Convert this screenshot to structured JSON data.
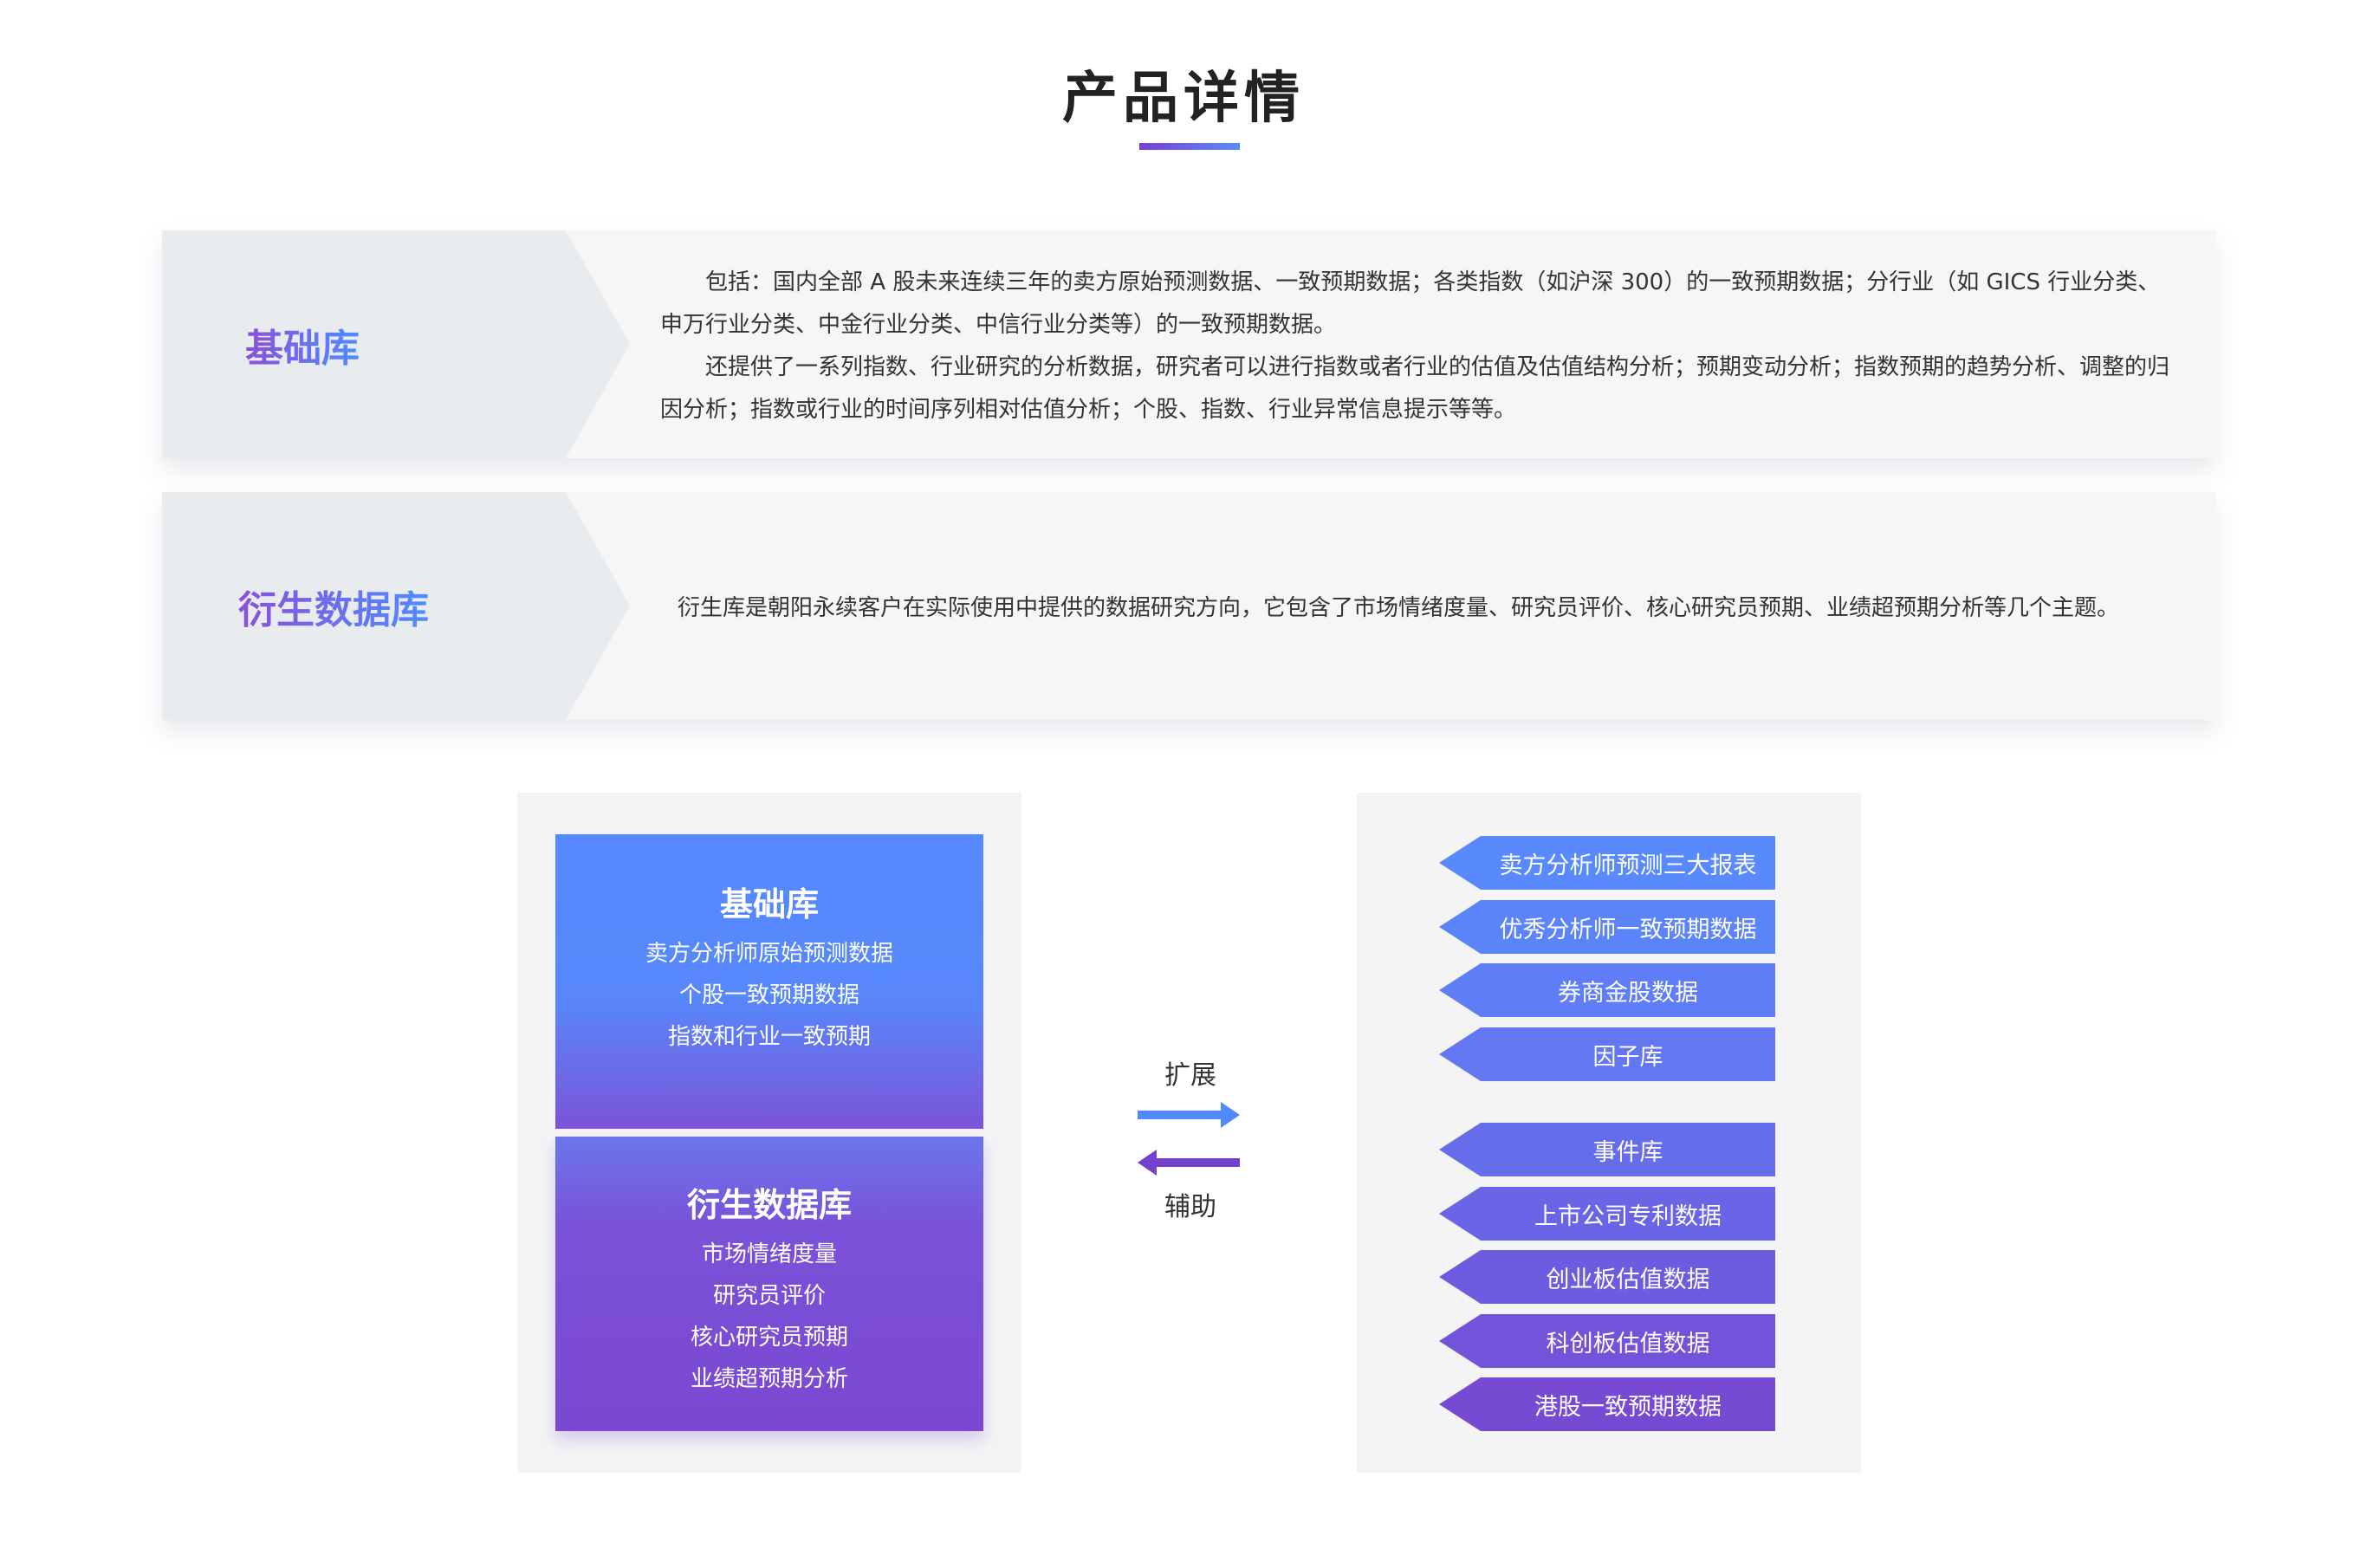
{
  "header": {
    "title": "产品详情"
  },
  "intro": {
    "basic": {
      "label": "基础库",
      "paragraphs": [
        "包括：国内全部 A 股未来连续三年的卖方原始预测数据、一致预期数据；各类指数（如沪深 300）的一致预期数据；分行业（如 GICS 行业分类、申万行业分类、中金行业分类、中信行业分类等）的一致预期数据。",
        "还提供了一系列指数、行业研究的分析数据，研究者可以进行指数或者行业的估值及估值结构分析；预期变动分析；指数预期的趋势分析、调整的归因分析；指数或行业的时间序列相对估值分析；个股、指数、行业异常信息提示等等。"
      ]
    },
    "derived": {
      "label": "衍生数据库",
      "text": "衍生库是朝阳永续客户在实际使用中提供的数据研究方向，它包含了市场情绪度量、研究员评价、核心研究员预期、业绩超预期分析等几个主题。"
    }
  },
  "diagram": {
    "basic_box": {
      "title": "基础库",
      "items": [
        "卖方分析师原始预测数据",
        "个股一致预期数据",
        "指数和行业一致预期"
      ]
    },
    "derived_box": {
      "title": "衍生数据库",
      "items": [
        "市场情绪度量",
        "研究员评价",
        "核心研究员预期",
        "业绩超预期分析"
      ]
    },
    "expand_label": "扩展",
    "assist_label": "辅助",
    "tags": [
      {
        "label": "卖方分析师预测三大报表",
        "color": "#5889fd"
      },
      {
        "label": "优秀分析师一致预期数据",
        "color": "#5b83fa"
      },
      {
        "label": "券商金股数据",
        "color": "#5f7df6"
      },
      {
        "label": "因子库",
        "color": "#6377f2"
      },
      {
        "label": "事件库",
        "color": "#666deb"
      },
      {
        "label": "上市公司专利数据",
        "color": "#6a64e6"
      },
      {
        "label": "创业板估值数据",
        "color": "#6e5ce0"
      },
      {
        "label": "科创板估值数据",
        "color": "#7253da"
      },
      {
        "label": "港股一致预期数据",
        "color": "#774ad3"
      }
    ]
  },
  "colors": {
    "accent_blue": "#4d8dff",
    "accent_purple": "#7a45d1",
    "arrow_right": "#4f8bff",
    "arrow_left": "#7440d0"
  }
}
